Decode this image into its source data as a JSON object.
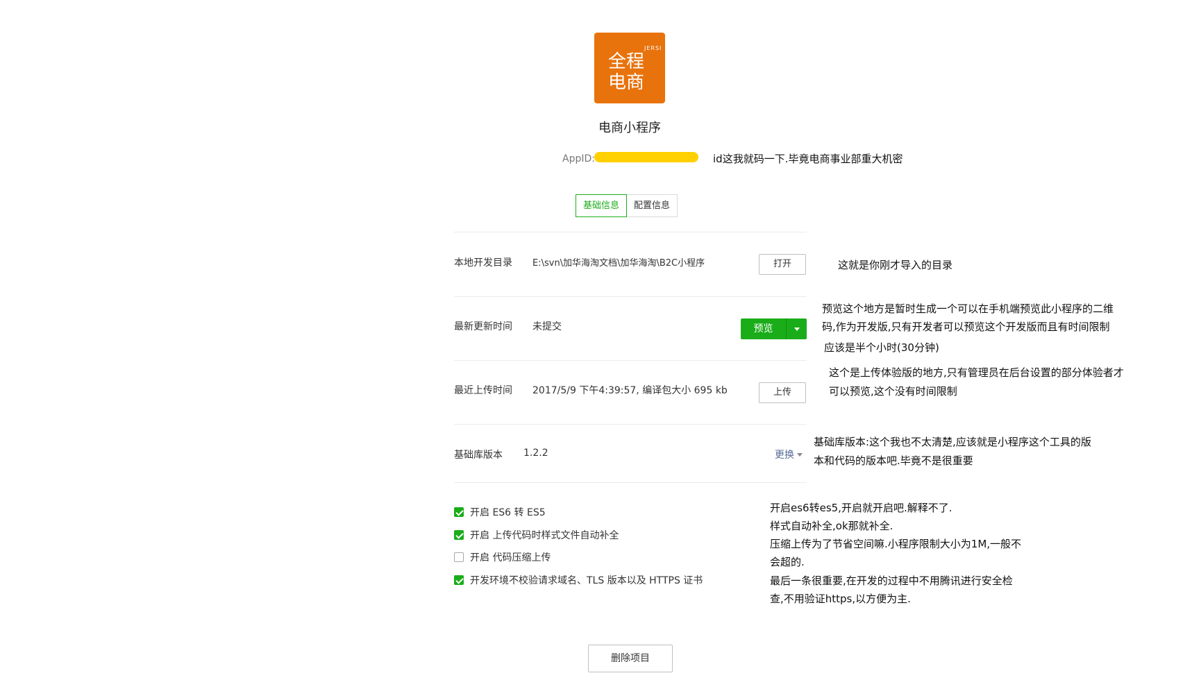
{
  "header": {
    "logo_text_top": "全程",
    "logo_text_bottom": "电商",
    "logo_brand": "JERSI",
    "app_name": "电商小程序",
    "appid_label": "AppID:",
    "appid_note": "id这我就码一下.毕竟电商事业部重大机密"
  },
  "tabs": [
    "基础信息",
    "配置信息"
  ],
  "rows": {
    "local_dir": {
      "label": "本地开发目录",
      "value": "E:\\svn\\加华海淘文档\\加华海淘\\B2C小程序",
      "button": "打开",
      "note": "这就是你刚才导入的目录"
    },
    "last_update": {
      "label": "最新更新时间",
      "value": "未提交",
      "button": "预览",
      "note": [
        "预览这个地方是暂时生成一个可以在手机端预览此小程序的二维",
        "码,作为开发版,只有开发者可以预览这个开发版而且有时间限制",
        "应该是半个小时(30分钟)"
      ]
    },
    "last_upload": {
      "label": "最近上传时间",
      "value": "2017/5/9 下午4:39:57, 编译包大小 695 kb",
      "button": "上传",
      "note": [
        "这个是上传体验版的地方,只有管理员在后台设置的部分体验者才",
        "可以预览,这个没有时间限制"
      ]
    },
    "lib_version": {
      "label": "基础库版本",
      "value": "1.2.2",
      "link": "更换",
      "note": [
        "基础库版本:这个我也不太清楚,应该就是小程序这个工具的版",
        "本和代码的版本吧.毕竟不是很重要"
      ]
    }
  },
  "options": [
    {
      "label": "开启 ES6 转 ES5",
      "checked": true
    },
    {
      "label": "开启 上传代码时样式文件自动补全",
      "checked": true
    },
    {
      "label": "开启 代码压缩上传",
      "checked": false
    },
    {
      "label": "开发环境不校验请求域名、TLS 版本以及 HTTPS 证书",
      "checked": true
    }
  ],
  "options_note": [
    "开启es6转es5,开启就开启吧.解释不了.",
    "样式自动补全,ok那就补全.",
    "压缩上传为了节省空间嘛.小程序限制大小为1M,一般不",
    "会超的.",
    "最后一条很重要,在开发的过程中不用腾讯进行安全检",
    "查,不用验证https,以方便为主."
  ],
  "delete_button": "删除项目",
  "colors": {
    "brand_orange": "#e8720c",
    "wechat_green": "#1aad19",
    "mask_yellow": "#ffd000"
  }
}
